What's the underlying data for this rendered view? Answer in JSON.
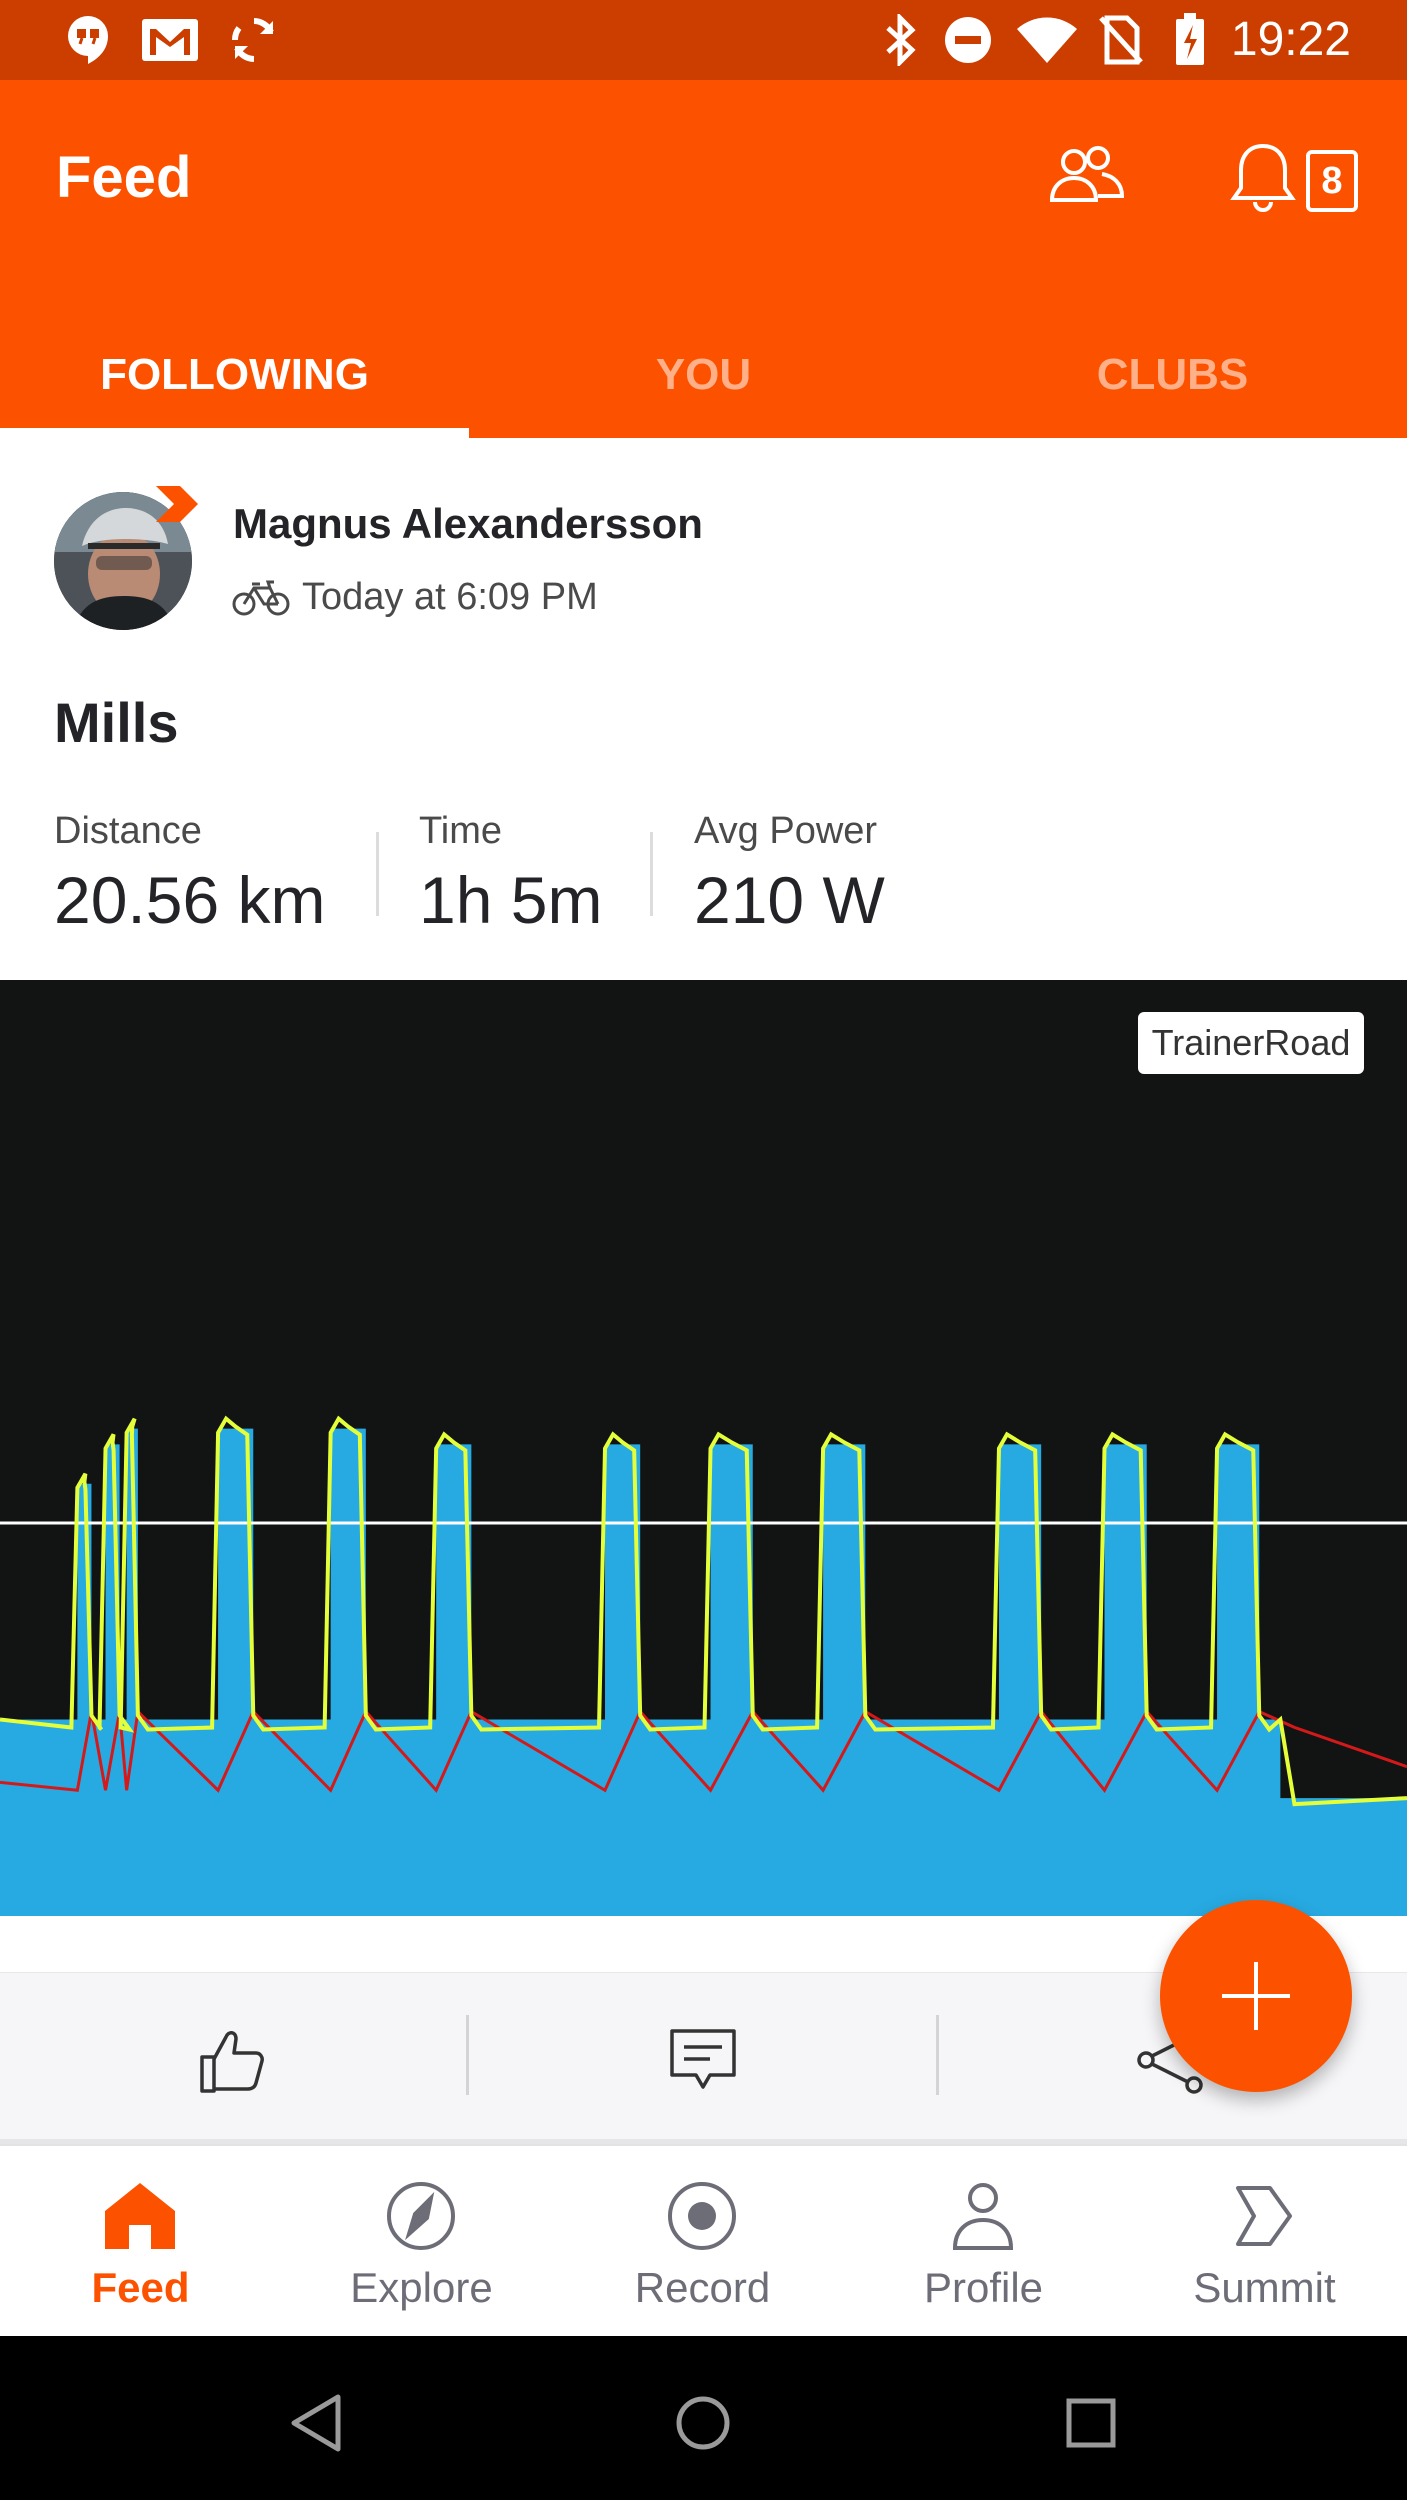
{
  "status_bar": {
    "time": "19:22",
    "icons": [
      "hangouts-icon",
      "gmail-icon",
      "sync-icon",
      "bluetooth-icon",
      "do-not-disturb-icon",
      "wifi-icon",
      "no-sim-icon",
      "battery-charging-icon"
    ]
  },
  "header": {
    "title": "Feed",
    "notification_count": "8",
    "icons": [
      "find-friends-icon",
      "notifications-bell-icon"
    ]
  },
  "tabs": [
    {
      "label": "FOLLOWING",
      "active": true
    },
    {
      "label": "YOU",
      "active": false
    },
    {
      "label": "CLUBS",
      "active": false
    }
  ],
  "post": {
    "athlete_name": "Magnus Alexandersson",
    "activity_type_icon": "bike-icon",
    "timestamp": "Today at 6:09 PM",
    "title": "Mills",
    "stats": [
      {
        "label": "Distance",
        "value": "20.56 km"
      },
      {
        "label": "Time",
        "value": "1h 5m"
      },
      {
        "label": "Avg Power",
        "value": "210 W"
      }
    ],
    "media_badge": "TrainerRoad"
  },
  "chart_data": {
    "type": "area",
    "title": "",
    "xlabel": "",
    "ylabel": "",
    "grid": false,
    "colors": {
      "target_power": "#27aae1",
      "power": "#e4ff3a",
      "heart_rate": "#d4191b",
      "ftp_line": "#ffffff",
      "background": "#121413"
    },
    "ftp_line_level": 0.5,
    "intervals": [
      {
        "start": 0.055,
        "end": 0.065,
        "level": 0.55
      },
      {
        "start": 0.075,
        "end": 0.085,
        "level": 0.6
      },
      {
        "start": 0.09,
        "end": 0.098,
        "level": 0.62
      },
      {
        "start": 0.155,
        "end": 0.18,
        "level": 0.62
      },
      {
        "start": 0.235,
        "end": 0.26,
        "level": 0.62
      },
      {
        "start": 0.31,
        "end": 0.335,
        "level": 0.6
      },
      {
        "start": 0.43,
        "end": 0.455,
        "level": 0.6
      },
      {
        "start": 0.505,
        "end": 0.535,
        "level": 0.6
      },
      {
        "start": 0.585,
        "end": 0.615,
        "level": 0.6
      },
      {
        "start": 0.71,
        "end": 0.74,
        "level": 0.6
      },
      {
        "start": 0.785,
        "end": 0.815,
        "level": 0.6
      },
      {
        "start": 0.865,
        "end": 0.895,
        "level": 0.6
      }
    ],
    "recovery_level": 0.25,
    "cooldown_level": 0.15
  },
  "actions": [
    {
      "name": "kudos",
      "icon": "thumbs-up-icon"
    },
    {
      "name": "comment",
      "icon": "comment-icon"
    },
    {
      "name": "share",
      "icon": "share-icon"
    }
  ],
  "fab": {
    "icon": "plus-icon"
  },
  "bottom_nav": [
    {
      "label": "Feed",
      "icon": "home-icon",
      "active": true
    },
    {
      "label": "Explore",
      "icon": "compass-icon",
      "active": false
    },
    {
      "label": "Record",
      "icon": "record-icon",
      "active": false
    },
    {
      "label": "Profile",
      "icon": "person-icon",
      "active": false
    },
    {
      "label": "Summit",
      "icon": "summit-icon",
      "active": false
    }
  ],
  "system_nav": [
    "back-icon",
    "home-circle-icon",
    "recents-icon"
  ],
  "colors": {
    "brand": "#fc5200",
    "status_bar": "#cc3d00",
    "text_dark": "#242428"
  }
}
